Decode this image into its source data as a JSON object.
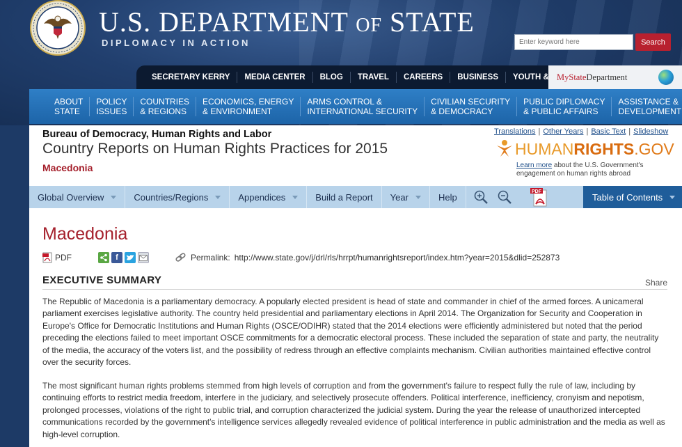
{
  "header": {
    "title_main": "U.S. DEPARTMENT",
    "title_of": "OF",
    "title_end": "STATE",
    "subtitle": "DIPLOMACY IN ACTION",
    "seal_icon": "dept-of-state-seal-icon"
  },
  "search": {
    "placeholder": "Enter keyword here",
    "button_label": "Search"
  },
  "top_nav": {
    "items": [
      "SECRETARY KERRY",
      "MEDIA CENTER",
      "BLOG",
      "TRAVEL",
      "CAREERS",
      "BUSINESS",
      "YOUTH & EDUCATION"
    ],
    "mystate_prefix": "My",
    "mystate_state": "State",
    "mystate_suffix": "Department"
  },
  "main_nav": {
    "items": [
      {
        "line1": "ABOUT",
        "line2": "STATE"
      },
      {
        "line1": "POLICY",
        "line2": "ISSUES"
      },
      {
        "line1": "COUNTRIES",
        "line2": "& REGIONS"
      },
      {
        "line1": "ECONOMICS, ENERGY",
        "line2": "& ENVIRONMENT"
      },
      {
        "line1": "ARMS CONTROL &",
        "line2": "INTERNATIONAL SECURITY"
      },
      {
        "line1": "CIVILIAN SECURITY",
        "line2": "& DEMOCRACY"
      },
      {
        "line1": "PUBLIC DIPLOMACY",
        "line2": "& PUBLIC AFFAIRS"
      },
      {
        "line1": "ASSISTANCE &",
        "line2": "DEVELOPMENT"
      }
    ]
  },
  "report": {
    "bureau": "Bureau of Democracy, Human Rights and Labor",
    "title": "Country Reports on Human Rights Practices for 2015",
    "country": "Macedonia"
  },
  "util_links": [
    "Translations",
    "Other Years",
    "Basic Text",
    "Slideshow"
  ],
  "humanrights": {
    "human": "HUMAN",
    "rights": "RIGHTS",
    "gov": ".GOV",
    "learn_more": "Learn more",
    "learn_text_1": " about the U.S. Government's",
    "learn_text_2": "engagement on human rights abroad"
  },
  "sub_nav": {
    "global_overview": "Global Overview",
    "countries_regions": "Countries/Regions",
    "appendices": "Appendices",
    "build_report": "Build a Report",
    "year": "Year",
    "help": "Help",
    "table_of_contents": "Table of Contents",
    "pdf_badge": "PDF"
  },
  "content": {
    "country_heading": "Macedonia",
    "pdf_label": "PDF",
    "permalink_label": "Permalink:",
    "permalink_url": "http://www.state.gov/j/drl/rls/hrrpt/humanrightsreport/index.htm?year=2015&dlid=252873",
    "section_title": "EXECUTIVE SUMMARY",
    "share_label": "Share",
    "paragraph_1": "The Republic of Macedonia is a parliamentary democracy. A popularly elected president is head of state and commander in chief of the armed forces. A unicameral parliament exercises legislative authority. The country held presidential and parliamentary elections in April 2014. The Organization for Security and Cooperation in Europe's Office for Democratic Institutions and Human Rights (OSCE/ODIHR) stated that the 2014 elections were efficiently administered but noted that the period preceding the elections failed to meet important OSCE commitments for a democratic electoral process. These included the separation of state and party, the neutrality of the media, the accuracy of the voters list, and the possibility of redress through an effective complaints mechanism. Civilian authorities maintained effective control over the security forces.",
    "paragraph_2": "The most significant human rights problems stemmed from high levels of corruption and from the government's failure to respect fully the rule of law, including by continuing efforts to restrict media freedom, interfere in the judiciary, and selectively prosecute offenders. Political interference, inefficiency, cronyism and nepotism, prolonged processes, violations of the right to public trial, and corruption characterized the judicial system. During the year the release of unauthorized intercepted communications recorded by the government's intelligence services allegedly revealed evidence of political interference in public administration and the media as well as high-level corruption."
  },
  "colors": {
    "header_bg": "#213f6e",
    "main_nav_bg": "#2f7fc6",
    "sub_nav_bg": "#b8d3ea",
    "toc_bg": "#1f5d9a",
    "accent_red": "#a5202c",
    "hr_orange": "#e07b1a"
  }
}
